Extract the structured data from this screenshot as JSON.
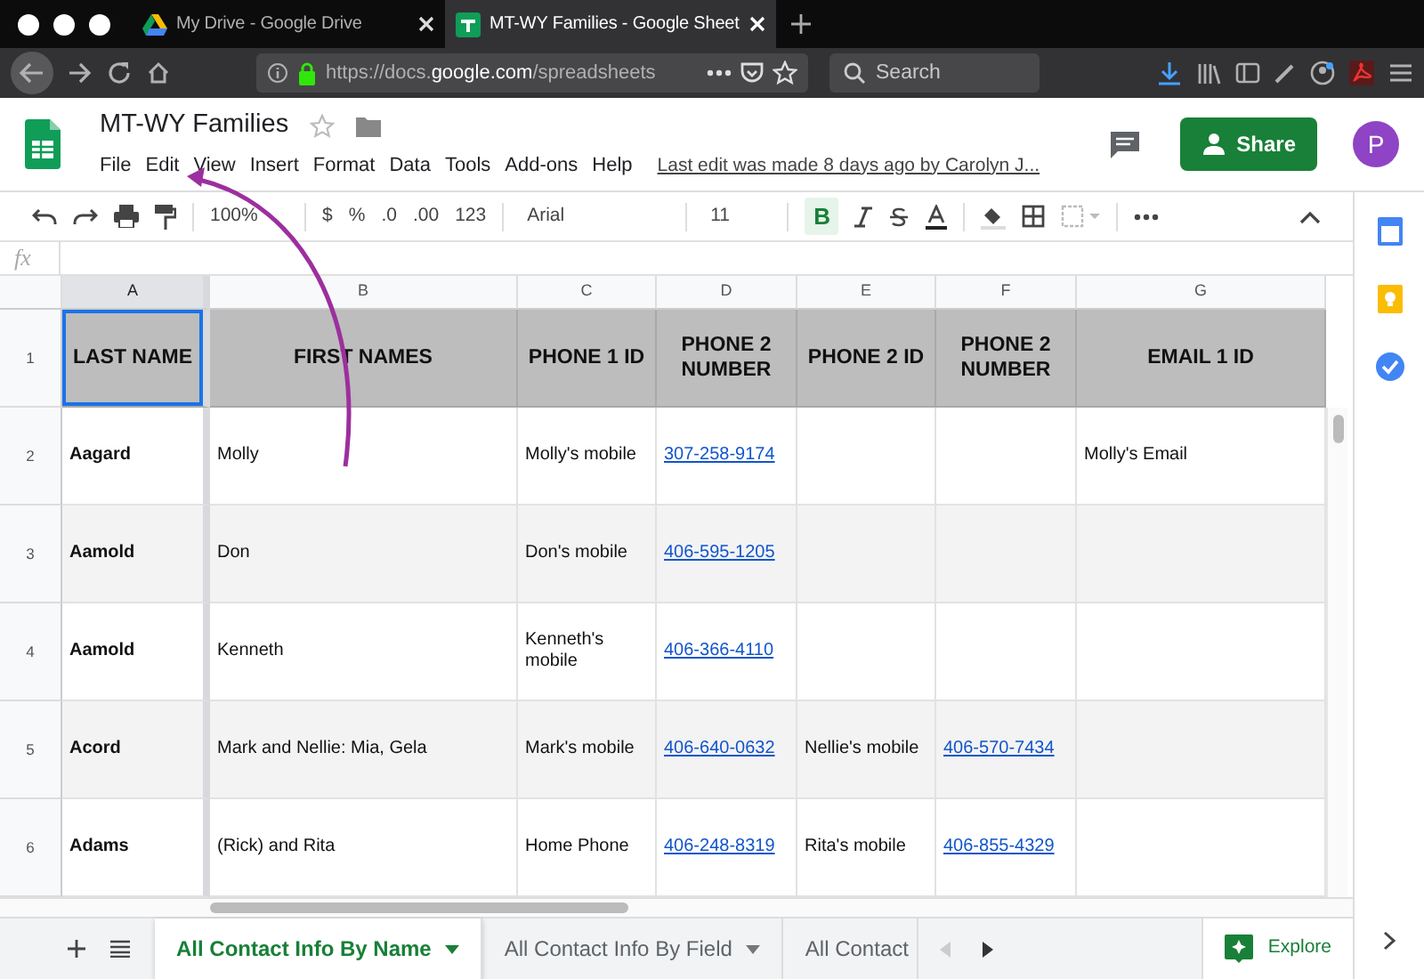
{
  "browser": {
    "tabs": [
      {
        "title": "My Drive - Google Drive",
        "kind": "drive",
        "selected": false
      },
      {
        "title": "MT-WY Families - Google Sheet",
        "kind": "sheets",
        "selected": true
      }
    ],
    "url": "https://docs.**google.com**/spreadsheets",
    "search": {
      "placeholder": "Search"
    }
  },
  "document": {
    "title": "MT-WY Families",
    "menus": [
      "File",
      "Edit",
      "View",
      "Insert",
      "Format",
      "Data",
      "Tools",
      "Add-ons",
      "Help"
    ],
    "last_edit": "Last edit was made 8 days ago by Carolyn J...",
    "share": "Share",
    "avatar": "P"
  },
  "toolbar": {
    "zoom": "100%",
    "currency": "$",
    "percent": "%",
    "decrease_decimals": ".0",
    "increase_decimals": ".00",
    "number_format": "123",
    "font": "Arial",
    "font_size": "11",
    "bold": {
      "label": "B",
      "on": true
    }
  },
  "formula_bar": {
    "label": "fx"
  },
  "columns": [
    {
      "letter": "A",
      "selected": true
    },
    {
      "letter": "B",
      "selected": false
    },
    {
      "letter": "C",
      "selected": false
    },
    {
      "letter": "D",
      "selected": false
    },
    {
      "letter": "E",
      "selected": false
    },
    {
      "letter": "F",
      "selected": false
    },
    {
      "letter": "G",
      "selected": false
    }
  ],
  "rows": [
    {
      "number": "1",
      "kind": "header",
      "cells": [
        {
          "text": "LAST NAME",
          "kind": "bold",
          "selected": true
        },
        {
          "text": "FIRST NAMES",
          "kind": "bold",
          "selected": false
        },
        {
          "text": "PHONE 1 ID",
          "kind": "bold",
          "selected": false
        },
        {
          "text": "PHONE 2 NUMBER",
          "kind": "bold",
          "selected": false
        },
        {
          "text": "PHONE 2 ID",
          "kind": "bold",
          "selected": false
        },
        {
          "text": "PHONE 2 NUMBER",
          "kind": "bold",
          "selected": false
        },
        {
          "text": "EMAIL 1 ID",
          "kind": "bold",
          "selected": false
        }
      ]
    },
    {
      "number": "2",
      "kind": "data",
      "cells": [
        {
          "text": "Aagard",
          "kind": "bold",
          "selected": false
        },
        {
          "text": "Molly",
          "kind": "plain",
          "selected": false
        },
        {
          "text": "Molly's mobile",
          "kind": "plain",
          "selected": false
        },
        {
          "text": "307-258-9174",
          "kind": "link",
          "selected": false
        },
        null,
        null,
        {
          "text": "Molly's Email",
          "kind": "plain",
          "selected": false
        }
      ]
    },
    {
      "number": "3",
      "kind": "data",
      "cells": [
        {
          "text": "Aamold",
          "kind": "bold",
          "selected": false
        },
        {
          "text": "Don",
          "kind": "plain",
          "selected": false
        },
        {
          "text": "Don's mobile",
          "kind": "plain",
          "selected": false
        },
        {
          "text": "406-595-1205",
          "kind": "link",
          "selected": false
        },
        null,
        null,
        null
      ]
    },
    {
      "number": "4",
      "kind": "data",
      "cells": [
        {
          "text": "Aamold",
          "kind": "bold",
          "selected": false
        },
        {
          "text": "Kenneth",
          "kind": "plain",
          "selected": false
        },
        {
          "text": "Kenneth's mobile",
          "kind": "plain",
          "selected": false
        },
        {
          "text": "406-366-4110",
          "kind": "link",
          "selected": false
        },
        null,
        null,
        null
      ]
    },
    {
      "number": "5",
      "kind": "data",
      "cells": [
        {
          "text": "Acord",
          "kind": "bold",
          "selected": false
        },
        {
          "text": "Mark and Nellie: Mia, Gela",
          "kind": "plain",
          "selected": false
        },
        {
          "text": "Mark's mobile",
          "kind": "plain",
          "selected": false
        },
        {
          "text": "406-640-0632",
          "kind": "link",
          "selected": false
        },
        {
          "text": "Nellie's mobile",
          "kind": "plain",
          "selected": false
        },
        {
          "text": "406-570-7434",
          "kind": "link",
          "selected": false
        },
        null
      ]
    },
    {
      "number": "6",
      "kind": "data",
      "cells": [
        {
          "text": "Adams",
          "kind": "bold",
          "selected": false
        },
        {
          "text": "(Rick) and Rita",
          "kind": "plain",
          "selected": false
        },
        {
          "text": "Home Phone",
          "kind": "plain",
          "selected": false
        },
        {
          "text": "406-248-8319",
          "kind": "link",
          "selected": false
        },
        {
          "text": "Rita's mobile",
          "kind": "plain",
          "selected": false
        },
        {
          "text": "406-855-4329",
          "kind": "link",
          "selected": false
        },
        null
      ]
    }
  ],
  "sheet_tabs": [
    {
      "label": "All Contact Info By Name",
      "selected": true
    },
    {
      "label": "All Contact Info By Field",
      "selected": false
    },
    {
      "label": "All Contact",
      "selected": false
    }
  ],
  "explore": "Explore"
}
